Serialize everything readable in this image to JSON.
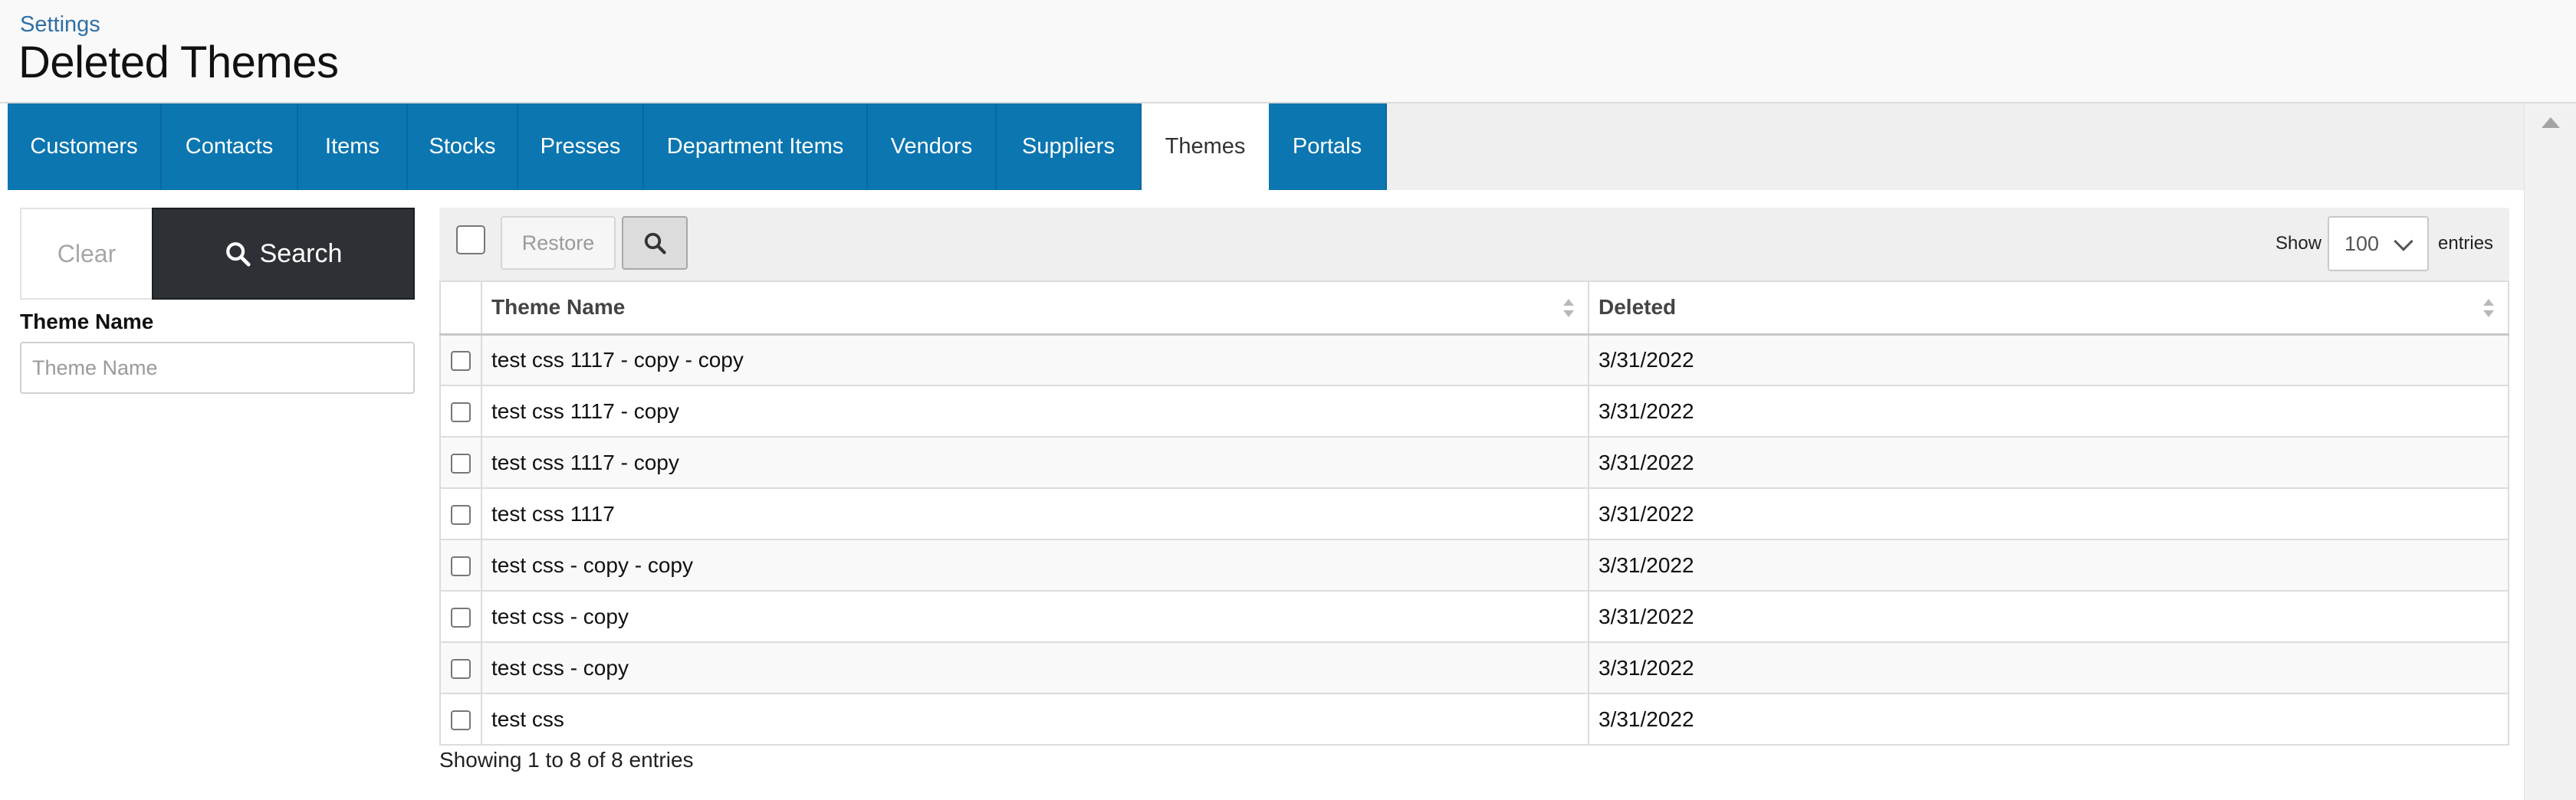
{
  "header": {
    "breadcrumb": "Settings",
    "title": "Deleted Themes"
  },
  "tabs": [
    {
      "label": "Customers",
      "active": false
    },
    {
      "label": "Contacts",
      "active": false
    },
    {
      "label": "Items",
      "active": false
    },
    {
      "label": "Stocks",
      "active": false
    },
    {
      "label": "Presses",
      "active": false
    },
    {
      "label": "Department Items",
      "active": false
    },
    {
      "label": "Vendors",
      "active": false
    },
    {
      "label": "Suppliers",
      "active": false
    },
    {
      "label": "Themes",
      "active": true
    },
    {
      "label": "Portals",
      "active": false
    }
  ],
  "filter": {
    "clear_label": "Clear",
    "search_label": "Search",
    "field_label": "Theme Name",
    "field_placeholder": "Theme Name",
    "field_value": ""
  },
  "toolbar": {
    "restore_label": "Restore",
    "show_label": "Show",
    "entries_value": "100",
    "entries_label": "entries"
  },
  "table": {
    "columns": [
      "Theme Name",
      "Deleted"
    ],
    "rows": [
      {
        "name": "test css 1117 - copy - copy",
        "deleted": "3/31/2022"
      },
      {
        "name": "test css 1117 - copy",
        "deleted": "3/31/2022"
      },
      {
        "name": "test css 1117 - copy",
        "deleted": "3/31/2022"
      },
      {
        "name": "test css 1117",
        "deleted": "3/31/2022"
      },
      {
        "name": "test css - copy - copy",
        "deleted": "3/31/2022"
      },
      {
        "name": "test css - copy",
        "deleted": "3/31/2022"
      },
      {
        "name": "test css - copy",
        "deleted": "3/31/2022"
      },
      {
        "name": "test css",
        "deleted": "3/31/2022"
      }
    ]
  },
  "info": "Showing 1 to 8 of 8 entries",
  "colors": {
    "tab_bg": "#0b76b0",
    "search_button_bg": "#2d3135",
    "breadcrumb_link": "#2f6fa5"
  }
}
